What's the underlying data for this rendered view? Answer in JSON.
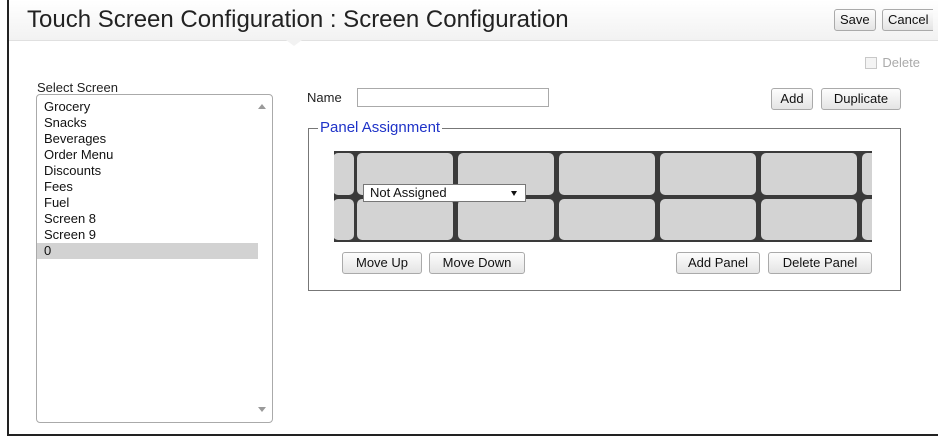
{
  "header": {
    "title": "Touch Screen Configuration : Screen Configuration",
    "save_label": "Save",
    "cancel_label": "Cancel"
  },
  "delete_toggle": {
    "label": "Delete",
    "checked": false
  },
  "screen_list": {
    "label": "Select Screen",
    "items": [
      "Grocery",
      "Snacks",
      "Beverages",
      "Order Menu",
      "Discounts",
      "Fees",
      "Fuel",
      "Screen 8",
      "Screen 9",
      "0"
    ],
    "selected": "0"
  },
  "name_field": {
    "label": "Name",
    "value": ""
  },
  "add_label": "Add",
  "duplicate_label": "Duplicate",
  "panel_assignment": {
    "legend": "Panel Assignment",
    "assignment_value": "Not Assigned",
    "move_up_label": "Move Up",
    "move_down_label": "Move Down",
    "add_panel_label": "Add Panel",
    "delete_panel_label": "Delete Panel"
  },
  "colors": {
    "legend": "#1f33c8",
    "panel_bg": "#3a3a3a",
    "tile": "#d3d3d3",
    "selected_row": "#d2d2d2"
  }
}
